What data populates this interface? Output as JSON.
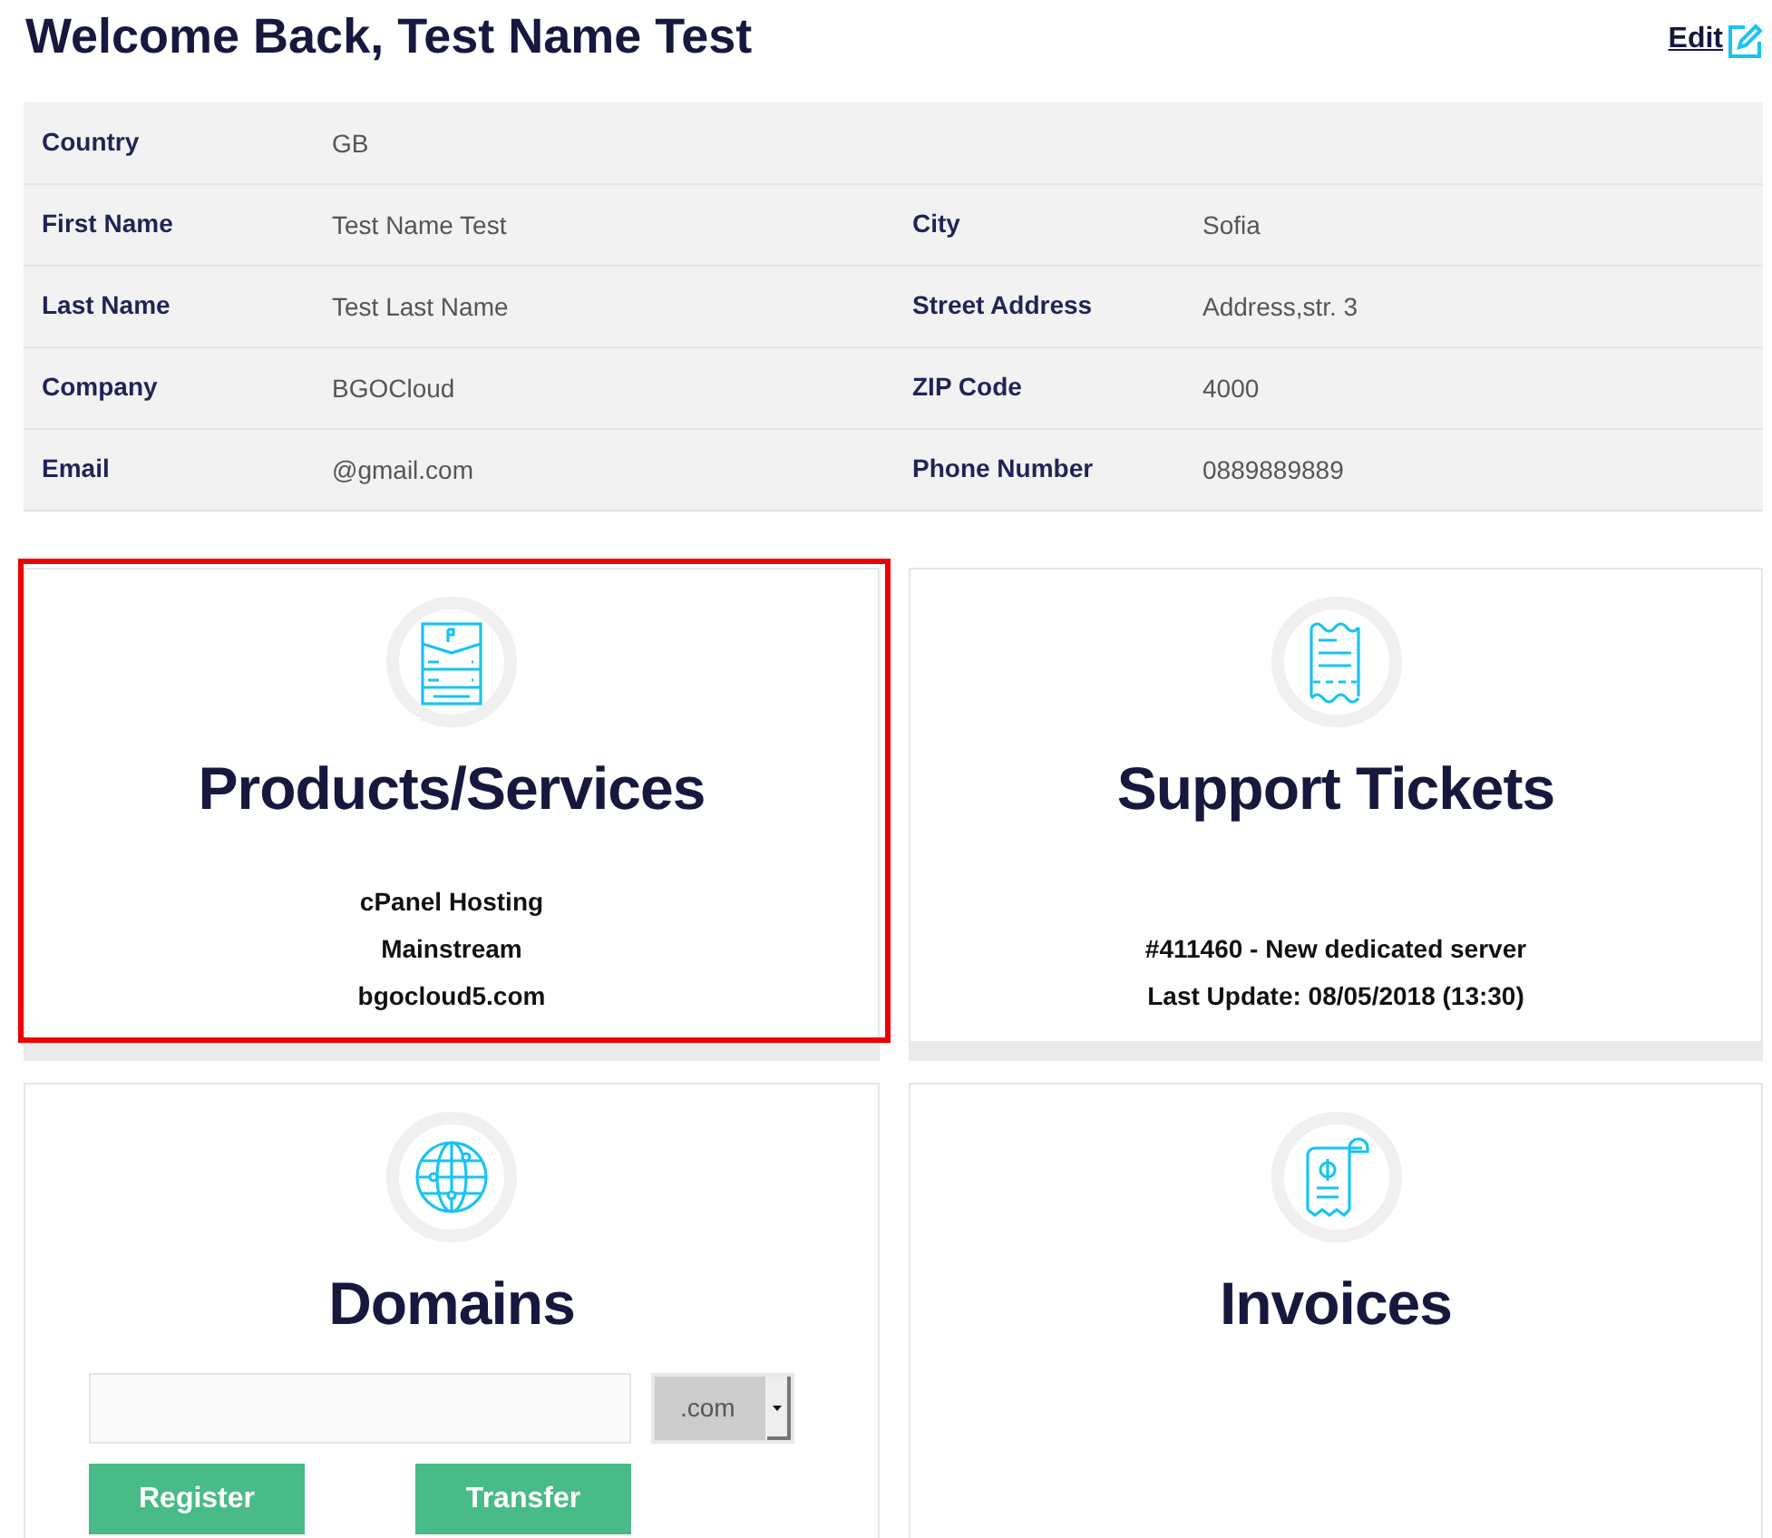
{
  "header": {
    "title": "Welcome Back, Test Name Test",
    "edit_link": "Edit"
  },
  "profile": {
    "rows": [
      {
        "fields": [
          {
            "label": "Country",
            "value": "GB"
          }
        ]
      },
      {
        "fields": [
          {
            "label": "First Name",
            "value": "Test Name Test"
          },
          {
            "label": "City",
            "value": "Sofia"
          }
        ]
      },
      {
        "fields": [
          {
            "label": "Last Name",
            "value": "Test Last Name"
          },
          {
            "label": "Street Address",
            "value": "Address,str. 3"
          }
        ]
      },
      {
        "fields": [
          {
            "label": "Company",
            "value": "BGOCloud"
          },
          {
            "label": "ZIP Code",
            "value": "4000"
          }
        ]
      },
      {
        "fields": [
          {
            "label": "Email",
            "value": "@gmail.com"
          },
          {
            "label": "Phone Number",
            "value": "0889889889"
          }
        ]
      }
    ]
  },
  "cards": [
    {
      "kind": "products",
      "title": "Products/Services",
      "highlighted": true,
      "lines": [
        "cPanel Hosting",
        "Mainstream",
        "bgocloud5.com"
      ]
    },
    {
      "kind": "tickets",
      "title": "Support Tickets",
      "highlighted": false,
      "lines": [
        "#411460 - New dedicated server",
        "Last Update: 08/05/2018 (13:30)"
      ]
    },
    {
      "kind": "domains",
      "title": "Domains",
      "highlighted": false,
      "domain_search": {
        "tld": ".com",
        "buttons": [
          "Register",
          "Transfer"
        ]
      }
    },
    {
      "kind": "invoices",
      "title": "Invoices",
      "highlighted": false
    }
  ]
}
